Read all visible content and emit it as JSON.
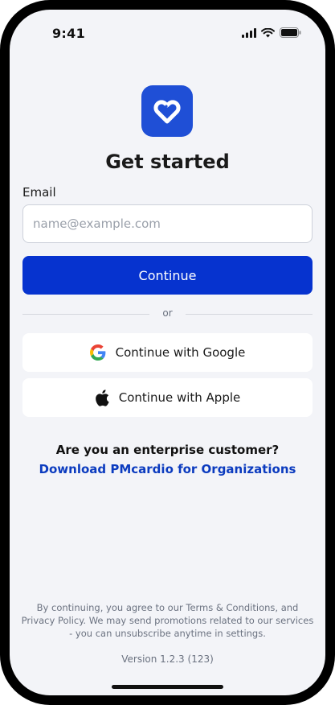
{
  "status_bar": {
    "time": "9:41"
  },
  "title": "Get started",
  "email": {
    "label": "Email",
    "placeholder": "name@example.com",
    "value": ""
  },
  "continue_label": "Continue",
  "divider_text": "or",
  "google_label": "Continue with Google",
  "apple_label": "Continue with Apple",
  "enterprise": {
    "question": "Are you an enterprise customer?",
    "link": "Download PMcardio for Organizations"
  },
  "legal": "By continuing, you agree to our Terms & Conditions, and Privacy Policy. We may send promotions related to our services - you can unsubscribe anytime in settings.",
  "version": "Version 1.2.3 (123)",
  "colors": {
    "primary": "#0633cf",
    "logo": "#1f4fd6",
    "link": "#0b3bbf",
    "background": "#f3f4f8"
  }
}
